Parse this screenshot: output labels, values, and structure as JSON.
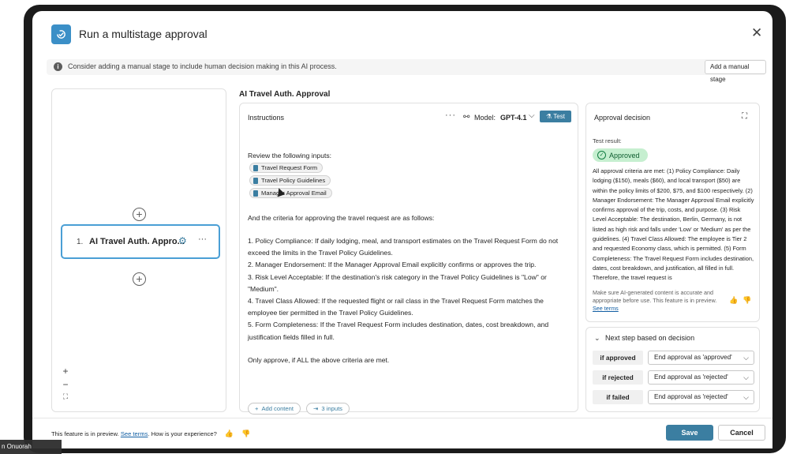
{
  "dialog": {
    "title": "Run a multistage approval",
    "close_icon": "close-icon"
  },
  "banner": {
    "text": "Consider adding a manual stage to include human decision making in this AI process.",
    "button": "Add a manual stage"
  },
  "stages": {
    "items": [
      {
        "number": "1.",
        "label": "AI Travel Auth. Appro..."
      }
    ],
    "zoom_in": "+",
    "zoom_out": "−",
    "fit": "⛶"
  },
  "instructions": {
    "section_title": "AI Travel Auth. Approval",
    "header": "Instructions",
    "more": "···",
    "model_label": "Model:",
    "model_value": "GPT-4.1",
    "test_button": "Test",
    "intro": "Review the following inputs:",
    "inputs": [
      "Travel Request Form",
      "Travel Policy Guidelines",
      "Manager Approval Email"
    ],
    "criteria_intro": "And the criteria for approving the travel request are as follows:",
    "criteria": [
      "1. Policy Compliance: If daily lodging, meal, and transport estimates on the Travel Request Form do not exceed the limits in the Travel Policy Guidelines.",
      "2. Manager Endorsement: If the Manager Approval Email explicitly confirms or approves the trip.",
      "3. Risk Level Acceptable: If the destination's risk category in the Travel Policy Guidelines is \"Low\" or \"Medium\".",
      "4. Travel Class Allowed: If the requested flight or rail class in the Travel Request Form matches the employee tier permitted in the Travel Policy Guidelines.",
      "5. Form Completeness: If the Travel Request Form includes destination, dates, cost breakdown, and justification fields filled in full."
    ],
    "closing": "Only approve, if ALL the above criteria are met.",
    "add_content": "Add content",
    "inputs_count": "3 inputs"
  },
  "approval": {
    "title": "Approval decision",
    "test_result_label": "Test result:",
    "result": "Approved",
    "explanation": "All approval criteria are met: (1) Policy Compliance: Daily lodging ($150), meals ($60), and local transport ($50) are within the policy limits of $200, $75, and $100 respectively. (2) Manager Endorsement: The Manager Approval Email explicitly confirms approval of the trip, costs, and purpose. (3) Risk Level Acceptable: The destination, Berlin, Germany, is not listed as high risk and falls under 'Low' or 'Medium' as per the guidelines. (4) Travel Class Allowed: The employee is Tier 2 and requested Economy class, which is permitted. (5) Form Completeness: The Travel Request Form includes destination, dates, cost breakdown, and justification, all filled in full. Therefore, the travel request is",
    "ai_note": "Make sure AI-generated content is accurate and appropriate before use. This feature is in preview.",
    "see_terms": "See terms"
  },
  "next_step": {
    "title": "Next step based on decision",
    "rows": [
      {
        "condition": "if approved",
        "action": "End approval as 'approved'"
      },
      {
        "condition": "if rejected",
        "action": "End approval as 'rejected'"
      },
      {
        "condition": "if failed",
        "action": "End approval as 'rejected'"
      }
    ]
  },
  "footer": {
    "preview_text": "This feature is in preview.",
    "see_terms": "See terms",
    "experience": ". How is your experience?",
    "save": "Save",
    "cancel": "Cancel"
  },
  "overlay": {
    "caller_name": "n Onuorah"
  },
  "colors": {
    "accent": "#3b7ea1",
    "stage_border": "#4a9fd5",
    "approved_bg": "#c6efd0"
  }
}
